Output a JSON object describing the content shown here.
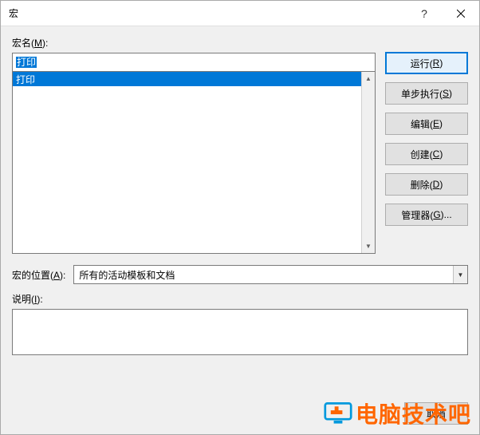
{
  "titlebar": {
    "title": "宏",
    "help": "?",
    "close": "×"
  },
  "labels": {
    "macro_name": "宏名(",
    "macro_name_key": "M",
    "macro_name_suffix": "):",
    "location": "宏的位置(",
    "location_key": "A",
    "location_suffix": "):",
    "description": "说明(",
    "description_key": "I",
    "description_suffix": "):"
  },
  "macro_name_value": "打印",
  "macro_list": [
    "打印"
  ],
  "buttons": {
    "run": "运行(",
    "run_key": "R",
    "run_suffix": ")",
    "step": "单步执行(",
    "step_key": "S",
    "step_suffix": ")",
    "edit": "编辑(",
    "edit_key": "E",
    "edit_suffix": ")",
    "create": "创建(",
    "create_key": "C",
    "create_suffix": ")",
    "delete": "删除(",
    "delete_key": "D",
    "delete_suffix": ")",
    "organizer": "管理器(",
    "organizer_key": "G",
    "organizer_suffix": ")...",
    "cancel": "取消"
  },
  "location_value": "所有的活动模板和文档",
  "watermark": "电脑技术吧"
}
